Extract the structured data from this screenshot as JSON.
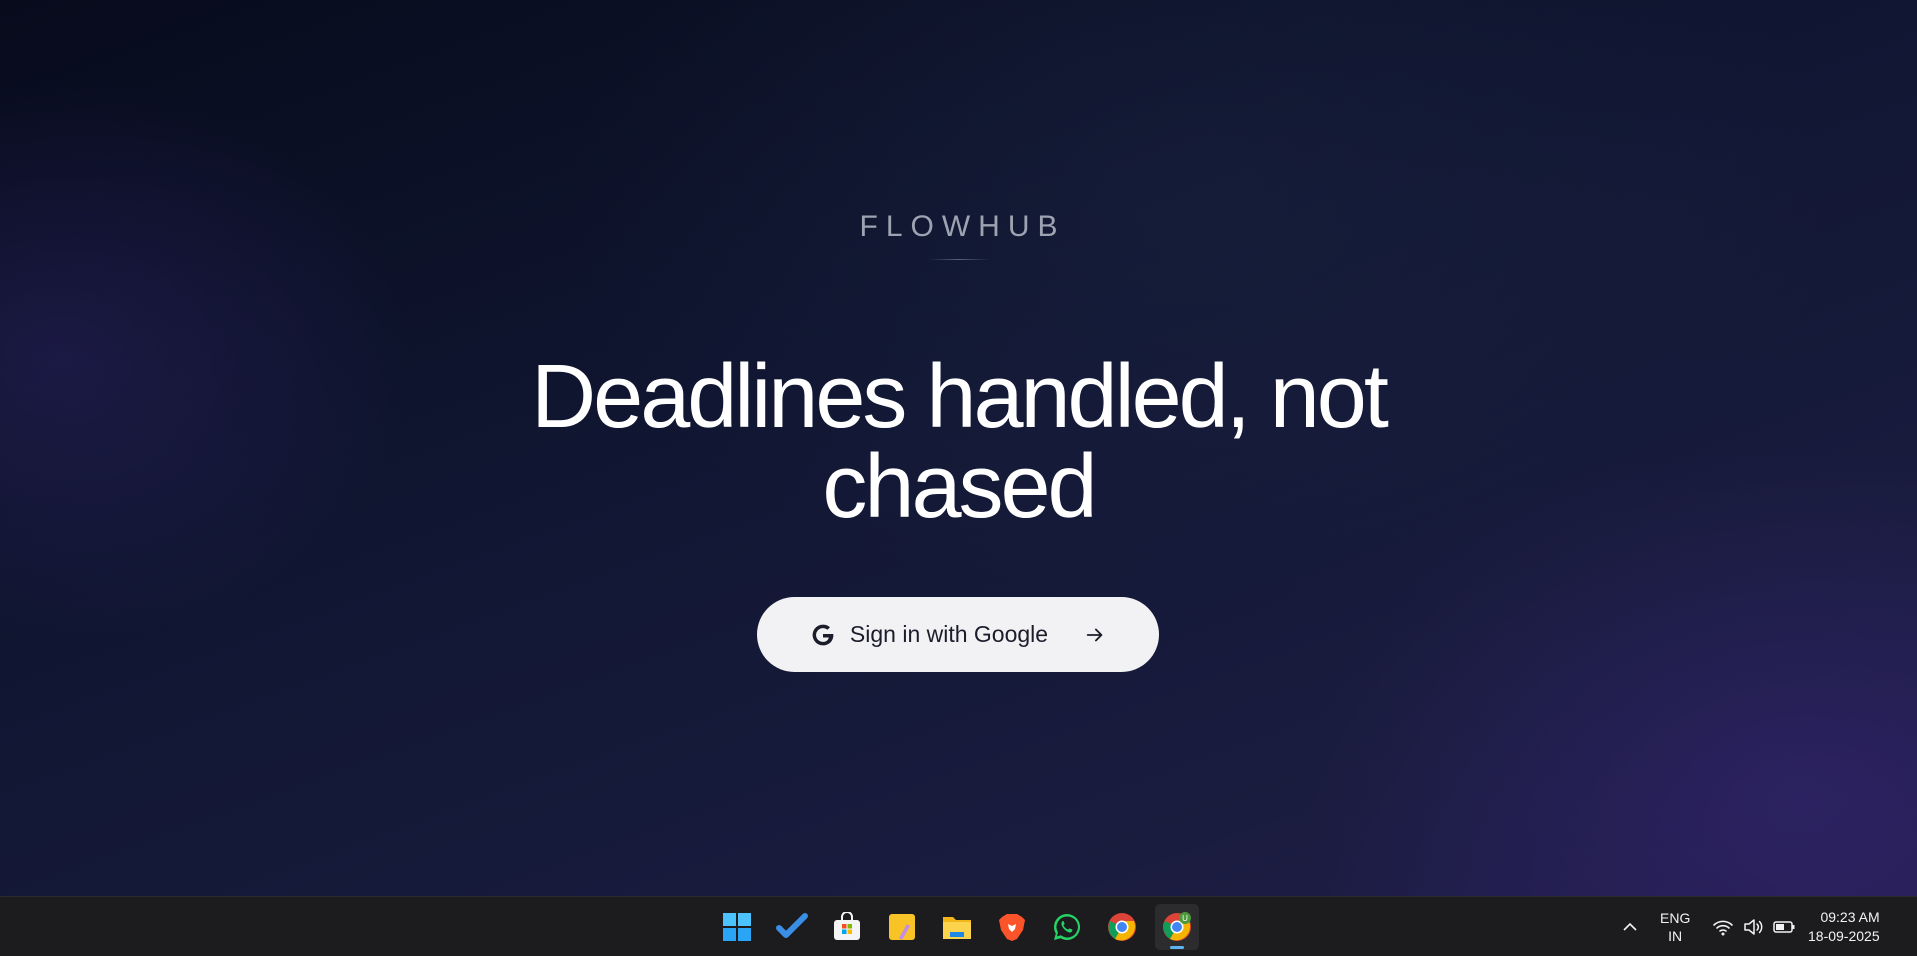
{
  "page": {
    "brand": "FLOWHUB",
    "headline_line1": "Deadlines handled, not",
    "headline_line2": "chased",
    "signin_label": "Sign in with Google"
  },
  "icons": {
    "google": "google-g-icon",
    "arrow": "arrow-right-icon"
  },
  "colors": {
    "background_dark": "#0b1022",
    "background_purple": "#221d4c",
    "button_bg": "#f2f2f4",
    "button_text": "#1b1d2a",
    "brand_text": "#9ea3b2",
    "taskbar_bg": "#1c1c1e"
  },
  "taskbar": {
    "apps": [
      {
        "name": "start",
        "icon": "windows-start-icon"
      },
      {
        "name": "todo",
        "icon": "microsoft-todo-icon"
      },
      {
        "name": "store",
        "icon": "microsoft-store-icon"
      },
      {
        "name": "sticky-notes",
        "icon": "sticky-notes-icon"
      },
      {
        "name": "file-explorer",
        "icon": "file-explorer-icon"
      },
      {
        "name": "brave",
        "icon": "brave-browser-icon"
      },
      {
        "name": "whatsapp",
        "icon": "whatsapp-icon"
      },
      {
        "name": "chrome",
        "icon": "chrome-icon"
      },
      {
        "name": "chrome-profile",
        "icon": "chrome-profile-icon",
        "badge": "U",
        "active": true
      }
    ],
    "tray": {
      "language_line1": "ENG",
      "language_line2": "IN",
      "time": "09:23 AM",
      "date": "18-09-2025"
    }
  }
}
